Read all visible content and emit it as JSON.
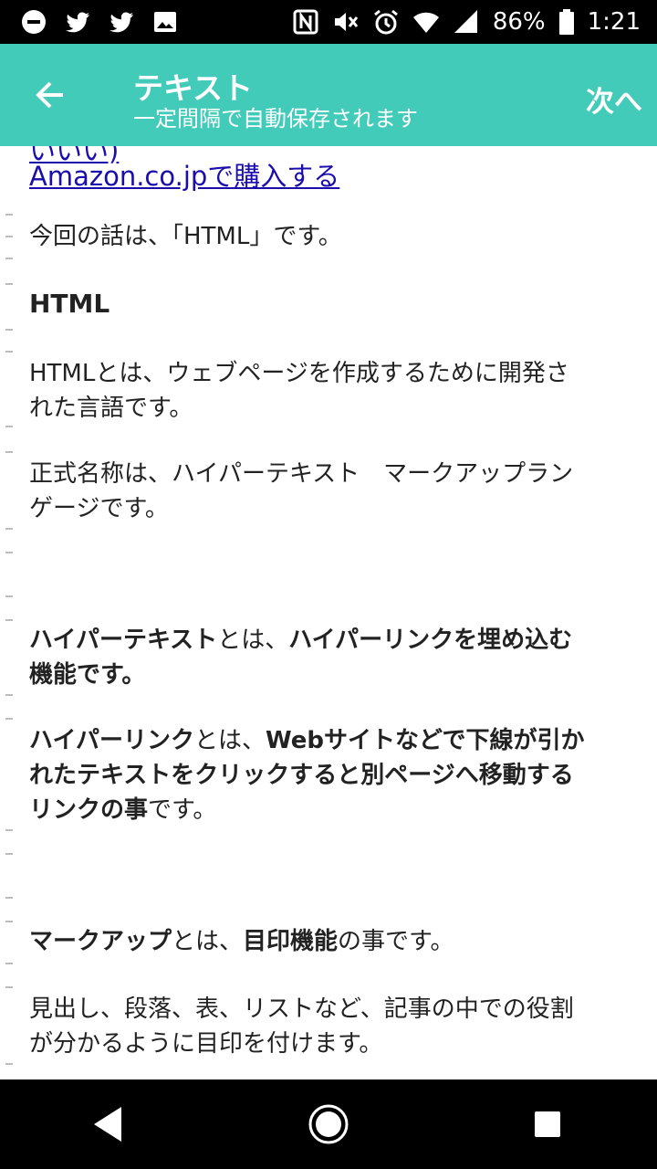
{
  "status_bar": {
    "battery": "86%",
    "time": "1:21"
  },
  "app_bar": {
    "title": "テキスト",
    "subtitle": "一定間隔で自動保存されます",
    "next_label": "次へ"
  },
  "content": {
    "cut_link": "いいい)",
    "amazon_link": "Amazon.co.jpで購入する",
    "intro": "今回の話は、「HTML」です。",
    "heading": "HTML",
    "p1_line1": "HTMLとは、ウェブページを作成するために開発さ",
    "p1_line2": "れた言語です。",
    "p2_line1": "正式名称は、ハイパーテキスト　マークアップラン",
    "p2_line2": "ゲージです。",
    "p3_bold1": "ハイパーテキスト",
    "p3_mid": "とは、",
    "p3_bold2": "ハイパーリンクを埋め込む",
    "p3_line2": "機能です。",
    "p4_bold1": "ハイパーリンク",
    "p4_mid": "とは、",
    "p4_bold2": "Webサイトなどで下線が引か",
    "p4_line2": "れたテキストをクリックすると別ページへ移動する",
    "p4_line3_bold": "リンクの事",
    "p4_line3_end": "です。",
    "p5_bold1": "マークアップ",
    "p5_mid": "とは、",
    "p5_bold2": "目印機能",
    "p5_end": "の事です。",
    "p6_line1": "見出し、段落、表、リストなど、記事の中での役割",
    "p6_line2": "が分かるように目印を付けます。"
  },
  "icons": {
    "status_left": [
      "minus-circle-icon",
      "twitter-icon",
      "twitter-icon",
      "image-icon"
    ],
    "status_right": [
      "nfc-icon",
      "mute-icon",
      "alarm-icon",
      "wifi-icon",
      "signal-icon",
      "battery-icon"
    ],
    "nav": [
      "back-triangle-icon",
      "home-circle-icon",
      "recents-square-icon"
    ]
  }
}
